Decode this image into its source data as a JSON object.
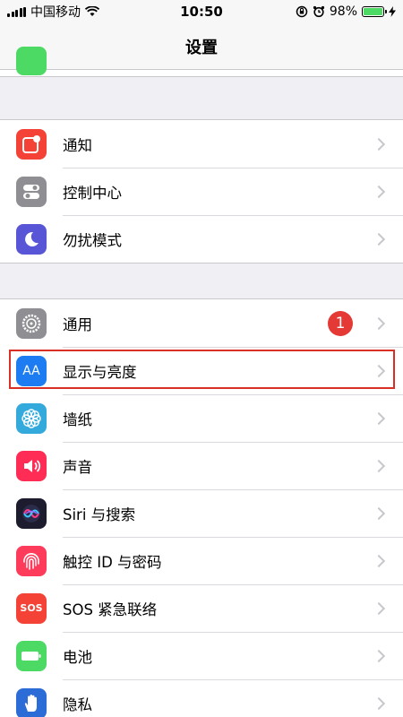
{
  "status": {
    "carrier": "中国移动",
    "time": "10:50",
    "battery": "98%",
    "battery_level": 0.98
  },
  "nav": {
    "title": "设置"
  },
  "group1": [
    {
      "label": "通知",
      "icon": "notifications-icon",
      "color": "#f44336"
    },
    {
      "label": "控制中心",
      "icon": "control-center-icon",
      "color": "#8e8e93"
    },
    {
      "label": "勿扰模式",
      "icon": "moon-icon",
      "color": "#5856d6"
    }
  ],
  "group2": [
    {
      "label": "通用",
      "icon": "gear-icon",
      "color": "#8e8e93",
      "badge": "1"
    },
    {
      "label": "显示与亮度",
      "icon": "display-aa-icon",
      "color": "#1e7cf2"
    },
    {
      "label": "墙纸",
      "icon": "wallpaper-flower-icon",
      "color": "#34aadc"
    },
    {
      "label": "声音",
      "icon": "speaker-icon",
      "color": "#ff2d55"
    },
    {
      "label": "Siri 与搜索",
      "icon": "siri-icon",
      "color": "#1c1c2e"
    },
    {
      "label": "触控 ID 与密码",
      "icon": "fingerprint-icon",
      "color": "#ff3b5c"
    },
    {
      "label": "SOS 紧急联络",
      "icon": "sos-icon",
      "color": "#f44336",
      "icon_text": "SOS"
    },
    {
      "label": "电池",
      "icon": "battery-icon",
      "color": "#4cd964"
    },
    {
      "label": "隐私",
      "icon": "hand-icon",
      "color": "#2c6cd6"
    }
  ],
  "display_icon_text": "AA"
}
